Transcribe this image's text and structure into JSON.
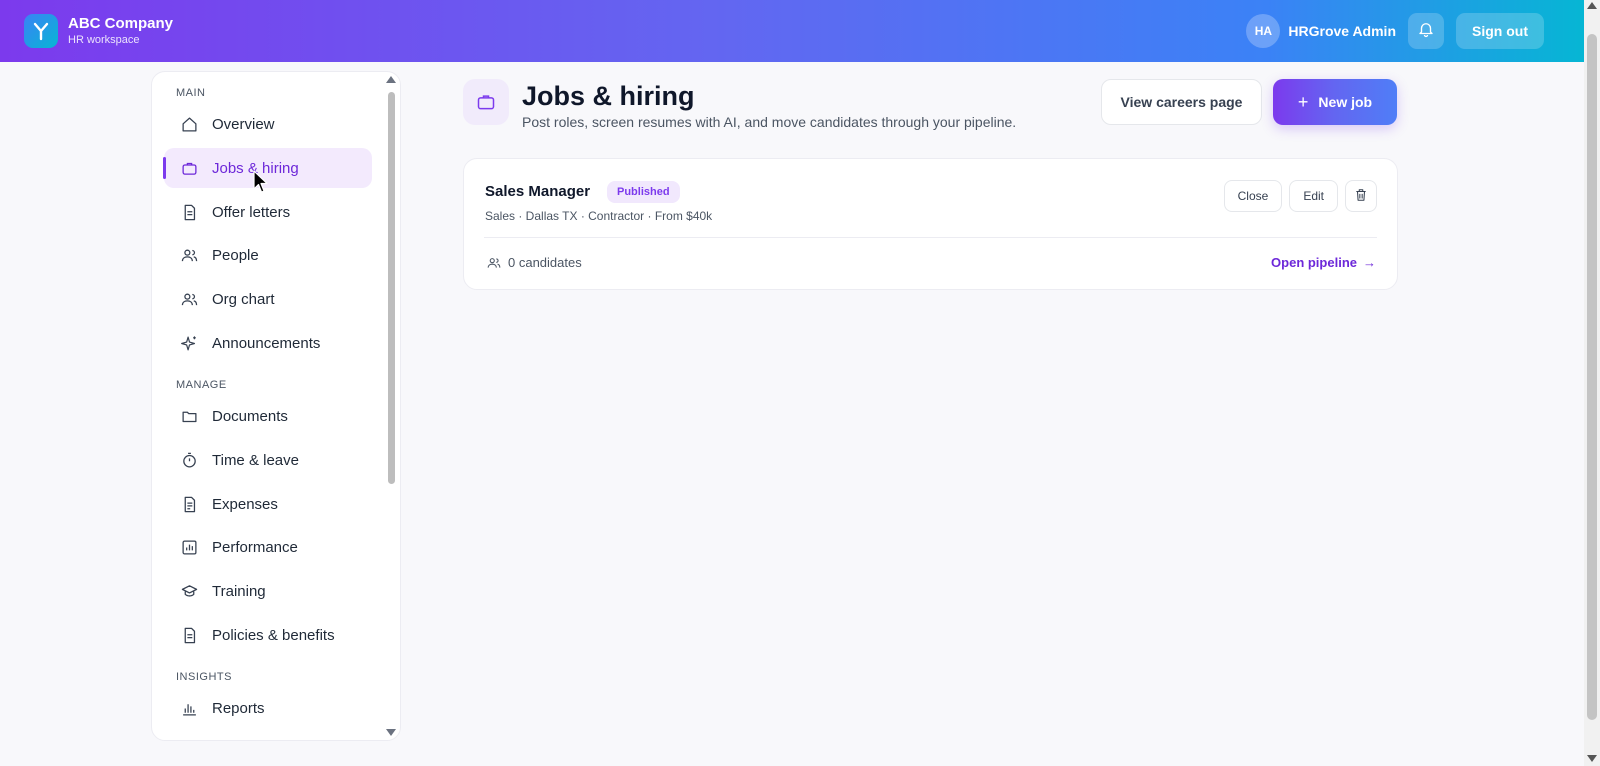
{
  "header": {
    "brand_name": "ABC Company",
    "brand_sub": "HR workspace",
    "avatar_initials": "HA",
    "user_name": "HRGrove Admin",
    "signout_label": "Sign out"
  },
  "sidebar": {
    "sections": [
      {
        "label": "MAIN",
        "items": [
          {
            "label": "Overview",
            "icon": "home-icon"
          },
          {
            "label": "Jobs & hiring",
            "icon": "briefcase-icon",
            "active": true
          },
          {
            "label": "Offer letters",
            "icon": "document-icon"
          },
          {
            "label": "People",
            "icon": "users-icon"
          },
          {
            "label": "Org chart",
            "icon": "users-icon"
          },
          {
            "label": "Announcements",
            "icon": "sparkle-icon"
          }
        ]
      },
      {
        "label": "MANAGE",
        "items": [
          {
            "label": "Documents",
            "icon": "folder-icon"
          },
          {
            "label": "Time & leave",
            "icon": "stopwatch-icon"
          },
          {
            "label": "Expenses",
            "icon": "receipt-icon"
          },
          {
            "label": "Performance",
            "icon": "chart-box-icon"
          },
          {
            "label": "Training",
            "icon": "graduation-cap-icon"
          },
          {
            "label": "Policies & benefits",
            "icon": "document-icon"
          }
        ]
      },
      {
        "label": "INSIGHTS",
        "items": [
          {
            "label": "Reports",
            "icon": "bar-chart-icon"
          }
        ]
      }
    ]
  },
  "main": {
    "title": "Jobs & hiring",
    "subtitle": "Post roles, screen resumes with AI, and move candidates through your pipeline.",
    "view_careers_label": "View careers page",
    "new_job_label": "New job",
    "jobs": [
      {
        "title": "Sales Manager",
        "status": "Published",
        "meta": "Sales · Dallas TX · Contractor · From $40k",
        "close_label": "Close",
        "edit_label": "Edit",
        "candidates": "0 candidates",
        "pipeline_label": "Open pipeline"
      }
    ]
  },
  "colors": {
    "accent": "#7c3aed",
    "header_gradient_start": "#7c3aed",
    "header_gradient_end": "#06b6d4",
    "active_bg": "#f3eafd"
  }
}
